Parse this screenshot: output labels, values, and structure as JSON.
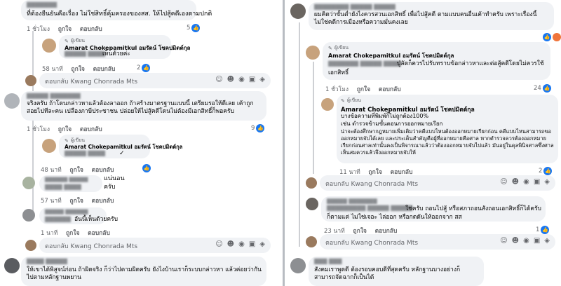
{
  "left": {
    "c1": {
      "text": "ที่ต้องยืนยันคือเรื่อง ไม่ใช่สิทธิ์คุ้มครองของสส. ให้ไปสู้คดีเองตามปกติ",
      "time": "1 ชั่วโมง",
      "like": "ถูกใจ",
      "reply": "ตอบกลับ",
      "count": "5"
    },
    "r1": {
      "badge": "ผู้เขียน",
      "name": "Amarat Chokepamitkul อมรัตน์ โชคปมิตต์กุล",
      "text": "เห็นด้วยค่ะ",
      "time": "58 นาที",
      "like": "ถูกใจ",
      "reply": "ตอบกลับ",
      "count": "2"
    },
    "input1": "ตอบกลับ Kwang Chonrada Mts",
    "c2": {
      "text": "จริงครับ ถ้าโดนกล่าวหาแล้วต้องลาออก ถ้าสร้างมาตรฐานแบบนี้ เตรียมรอให้ดีเลย เค้าถูกสอยไปทีละคน เปลืองภาษีประชาชน ปล่อยให้ไปสู้คดีโดนไม่ต้องมีเอกสิทธิ์ก็พอครับ",
      "time": "1 ชั่วโมง",
      "like": "ถูกใจ",
      "reply": "ตอบกลับ",
      "count": "9"
    },
    "r2": {
      "badge": "ผู้เขียน",
      "name": "Amarat Chokepamitkul อมรัตน์ โชคปมิตต์กุล",
      "text": "✓",
      "time": "48 นาที",
      "like": "ถูกใจ",
      "reply": "ตอบกลับ"
    },
    "r3": {
      "text": "แน่นอนครับ",
      "time": "57 นาที",
      "like": "ถูกใจ",
      "reply": "ตอบกลับ"
    },
    "r4": {
      "text": "อันนี้เห็นด้วยครับ",
      "time": "1 นาที",
      "like": "ถูกใจ",
      "reply": "ตอบกลับ"
    },
    "input2": "ตอบกลับ Kwang Chonrada Mts",
    "c3": {
      "text": "ให้เขาได้พิสูจน์ก่อน ถ้าผิดจริง ก็ว่าไปตามผิดครับ ยังไงบ้านเราก็ระบบกล่าวหา แล้วค่อยว่ากันไปตามหลักฐานพยาน"
    }
  },
  "right": {
    "c1": {
      "text": "ผมคิดว่าขั้นต่ำยังไงควรสวนเอกสิทธิ์ เพื่อไปสู้คดี ตามแบบคนอื่นเค้าทำครับ เพราะเรื่องนี้ไม่ใช่คดีการเมืองหรือความมั่นคงเลย"
    },
    "r1": {
      "badge": "ผู้เขียน",
      "text": "ปู่ลัดก็ควรไปรับทราบข้อกล่าวหาและต่อสู้คดีโดยไม่ควรใช้เอกสิทธิ์",
      "time": "1 ชั่วโมง",
      "like": "ถูกใจ",
      "reply": "ตอบกลับ",
      "count": "24"
    },
    "r2": {
      "badge": "ผู้เขียน",
      "name": "Amarat Chokepamitkul อมรัตน์ โชคปมิตต์กุล",
      "lines": [
        "บางข้อความที่พิมพ์ก็ไม่ถูกต้อง100%",
        "เช่น ตำรวจข้ามขั้นตอนการออกหมายเรียก",
        "น่าจะต้องศึกษากฎหมายเพิ่มเติมว่าคดีแบบไหนต้องออกหมายเรียกก่อน คดีแบบไหนสามารถขอออกหมายจับได้เลย และประเด็นสำคัญคือผู้ที่ออกหมายคือศาล หากตำรวจควรต้องออกหมายเรียกก่อนศาลเท่านั้นคงเป็นพิจารณาแล้วว่าต้องออกหมายจับไปแล้ว มันอยู่ในดุลพินิจศาลซึ่งศาลเห็นสมควรแล้วจึงออกหมายจับให้"
      ],
      "time": "11 นาที",
      "like": "ถูกใจ",
      "reply": "ตอบกลับ",
      "count": "2"
    },
    "input1": "ตอบกลับ Kwang Chonrada Mts",
    "r3": {
      "text": "ใช่ครับ ถอนไปสู้ หรือสภาถอนสังถอนเอกสิทธิ์ก็ได้ครับ ก็ตามแต่ ไม่ใช่เจอะ ไล่ออก หรือกดดันให้ออกจาก สส",
      "time": "23 นาที",
      "like": "ถูกใจ",
      "reply": "ตอบกลับ",
      "count": "1"
    },
    "input2": "ตอบกลับ Kwang Chonrada Mts",
    "c2": {
      "text": "สังคมเราพูดดี ต้องรอบคอบดีที่สุดครับ หลักฐานบางอย่างก็สามารถจัดฉากก็เป็นได้"
    }
  },
  "icons": [
    "emoji-icon",
    "gif-icon",
    "camera-icon",
    "sticker-icon",
    "avatar-icon"
  ],
  "colors": {
    "bubble": "#f0f2f5",
    "like": "#1877f2",
    "meta": "#65676b",
    "divider": "#b8bcc2"
  }
}
